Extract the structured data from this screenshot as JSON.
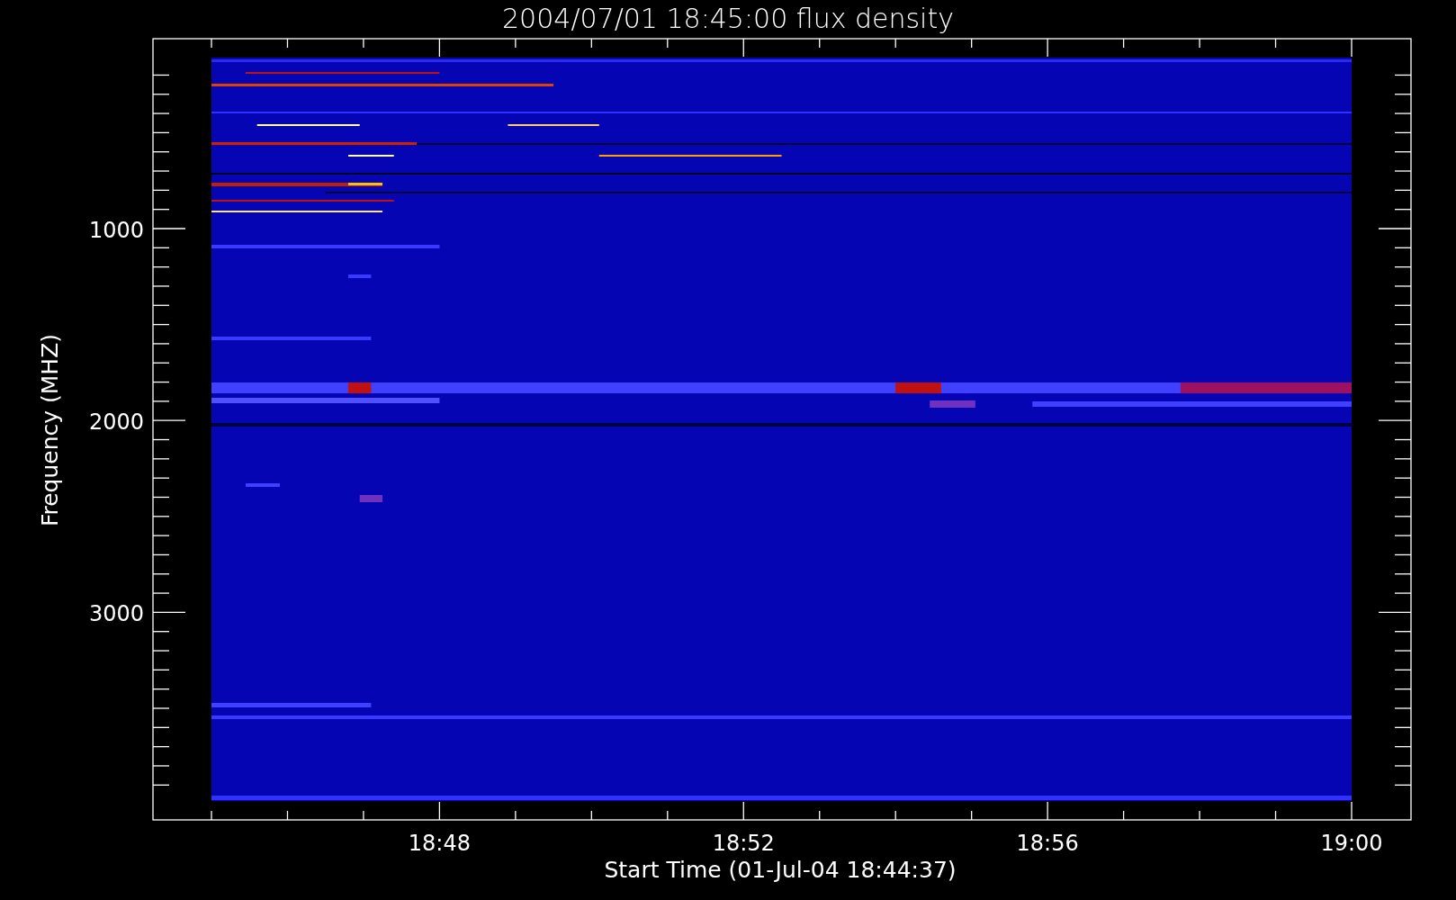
{
  "plot": {
    "title": "2004/07/01 18:45:00 flux density",
    "y_axis": {
      "label": "Frequency (MHZ)",
      "ticks": [
        "1000",
        "2000",
        "3000"
      ]
    },
    "x_axis": {
      "label": "Start Time (01-Jul-04 18:44:37)",
      "ticks": [
        "18:48",
        "18:52",
        "18:56",
        "19:00"
      ]
    }
  }
}
